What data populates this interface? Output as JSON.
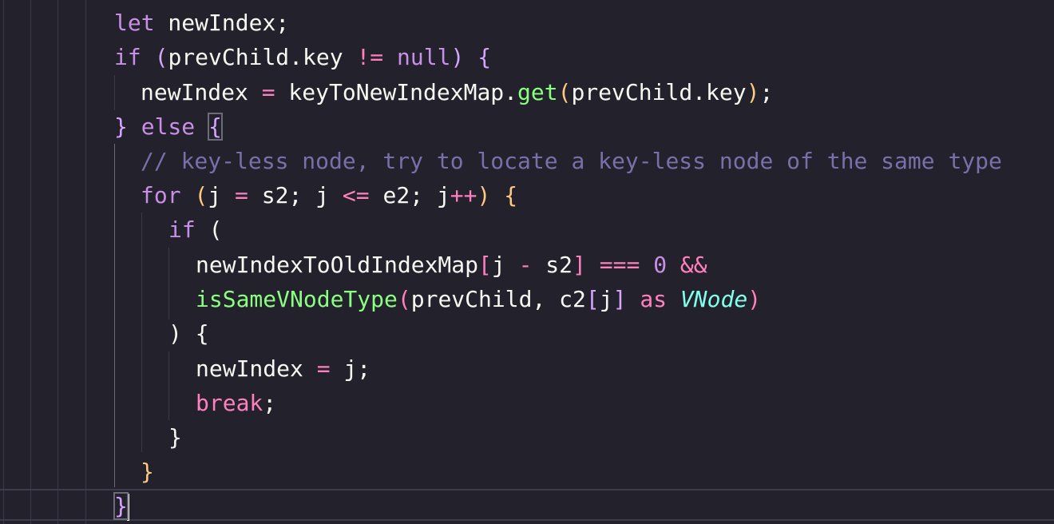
{
  "editor": {
    "lines": [
      {
        "id": "l1",
        "tokens": [
          {
            "t": "let",
            "c": "kw"
          },
          {
            "t": " newIndex;",
            "c": "plain"
          }
        ]
      },
      {
        "id": "l2",
        "tokens": [
          {
            "t": "if",
            "c": "kw"
          },
          {
            "t": " ",
            "c": "plain"
          },
          {
            "t": "(",
            "c": "p1"
          },
          {
            "t": "prevChild.key ",
            "c": "plain"
          },
          {
            "t": "!=",
            "c": "op"
          },
          {
            "t": " ",
            "c": "plain"
          },
          {
            "t": "null",
            "c": "kw"
          },
          {
            "t": ")",
            "c": "p1"
          },
          {
            "t": " ",
            "c": "plain"
          },
          {
            "t": "{",
            "c": "p1"
          }
        ]
      },
      {
        "id": "l3",
        "tokens": [
          {
            "t": "newIndex ",
            "c": "plain"
          },
          {
            "t": "=",
            "c": "op"
          },
          {
            "t": " keyToNewIndexMap.",
            "c": "plain"
          },
          {
            "t": "get",
            "c": "fn"
          },
          {
            "t": "(",
            "c": "p2"
          },
          {
            "t": "prevChild.key",
            "c": "plain"
          },
          {
            "t": ")",
            "c": "p2"
          },
          {
            "t": ";",
            "c": "plain"
          }
        ]
      },
      {
        "id": "l4",
        "tokens": [
          {
            "t": "}",
            "c": "p1"
          },
          {
            "t": " ",
            "c": "plain"
          },
          {
            "t": "else",
            "c": "kw"
          },
          {
            "t": " ",
            "c": "plain"
          },
          {
            "t": "{",
            "c": "p1",
            "m": true
          }
        ]
      },
      {
        "id": "l5",
        "tokens": [
          {
            "t": "// key-less node, try to locate a key-less node of the same type",
            "c": "cmt"
          }
        ]
      },
      {
        "id": "l6",
        "tokens": [
          {
            "t": "for",
            "c": "kw"
          },
          {
            "t": " ",
            "c": "plain"
          },
          {
            "t": "(",
            "c": "p2"
          },
          {
            "t": "j ",
            "c": "plain"
          },
          {
            "t": "=",
            "c": "op"
          },
          {
            "t": " s2; j ",
            "c": "plain"
          },
          {
            "t": "<=",
            "c": "op"
          },
          {
            "t": " e2; j",
            "c": "plain"
          },
          {
            "t": "++",
            "c": "op"
          },
          {
            "t": ")",
            "c": "p2"
          },
          {
            "t": " ",
            "c": "plain"
          },
          {
            "t": "{",
            "c": "p2"
          }
        ]
      },
      {
        "id": "l7",
        "tokens": [
          {
            "t": "if",
            "c": "kw"
          },
          {
            "t": " (",
            "c": "plain"
          }
        ]
      },
      {
        "id": "l8",
        "tokens": [
          {
            "t": "newIndexToOldIndexMap",
            "c": "plain"
          },
          {
            "t": "[",
            "c": "p3"
          },
          {
            "t": "j ",
            "c": "plain"
          },
          {
            "t": "-",
            "c": "op"
          },
          {
            "t": " s2",
            "c": "plain"
          },
          {
            "t": "]",
            "c": "p3"
          },
          {
            "t": " ",
            "c": "plain"
          },
          {
            "t": "===",
            "c": "op"
          },
          {
            "t": " ",
            "c": "plain"
          },
          {
            "t": "0",
            "c": "num"
          },
          {
            "t": " ",
            "c": "plain"
          },
          {
            "t": "&&",
            "c": "op"
          }
        ]
      },
      {
        "id": "l9",
        "tokens": [
          {
            "t": "isSameVNodeType",
            "c": "fn"
          },
          {
            "t": "(",
            "c": "p3"
          },
          {
            "t": "prevChild, c2",
            "c": "plain"
          },
          {
            "t": "[",
            "c": "p1"
          },
          {
            "t": "j",
            "c": "plain"
          },
          {
            "t": "]",
            "c": "p1"
          },
          {
            "t": " ",
            "c": "plain"
          },
          {
            "t": "as",
            "c": "kw2"
          },
          {
            "t": " ",
            "c": "plain"
          },
          {
            "t": "VNode",
            "c": "typ"
          },
          {
            "t": ")",
            "c": "p3"
          }
        ]
      },
      {
        "id": "l10",
        "tokens": [
          {
            "t": ") {",
            "c": "plain"
          }
        ]
      },
      {
        "id": "l11",
        "tokens": [
          {
            "t": "newIndex ",
            "c": "plain"
          },
          {
            "t": "=",
            "c": "op"
          },
          {
            "t": " j;",
            "c": "plain"
          }
        ]
      },
      {
        "id": "l12",
        "tokens": [
          {
            "t": "break",
            "c": "kw2"
          },
          {
            "t": ";",
            "c": "plain"
          }
        ]
      },
      {
        "id": "l13",
        "tokens": [
          {
            "t": "}",
            "c": "plain"
          }
        ]
      },
      {
        "id": "l14",
        "tokens": [
          {
            "t": "}",
            "c": "p2"
          }
        ]
      },
      {
        "id": "l15",
        "tokens": [
          {
            "t": "}",
            "c": "p1",
            "m": true,
            "cursor": true
          }
        ]
      }
    ]
  },
  "colors": {
    "background": "#22212c",
    "keyword": "#c98fe6",
    "operator": "#ff80bf",
    "function": "#8aff80",
    "comment": "#7970a9",
    "type": "#80ffea",
    "bracket_1": "#d6a5ff",
    "bracket_2": "#ffca80",
    "bracket_3": "#ff80bf",
    "text": "#f8f8f2"
  }
}
